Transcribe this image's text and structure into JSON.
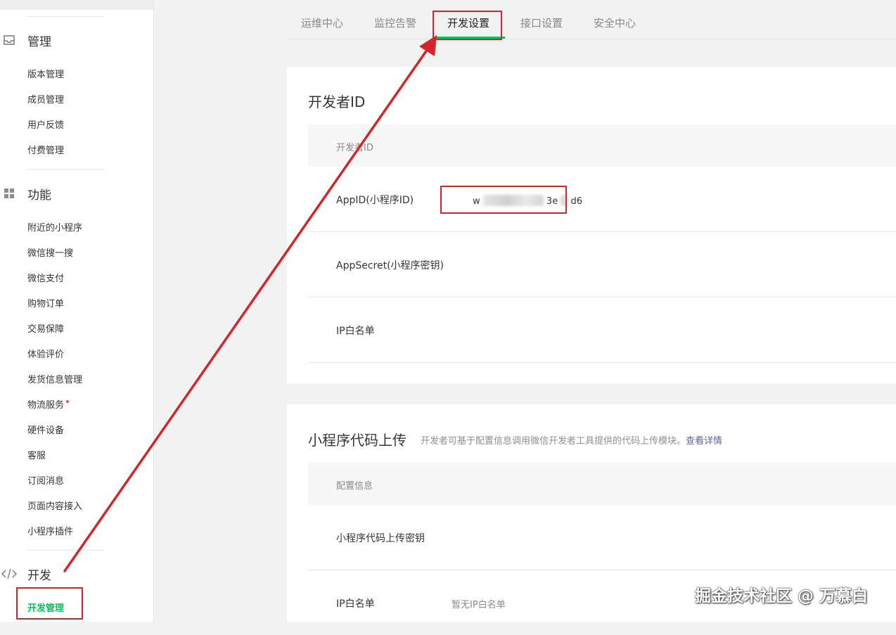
{
  "sidebar": {
    "sections": [
      {
        "title": "管理",
        "icon": "inbox-icon",
        "items": [
          "版本管理",
          "成员管理",
          "用户反馈",
          "付费管理"
        ]
      },
      {
        "title": "功能",
        "icon": "grid-icon",
        "items": [
          "附近的小程序",
          "微信搜一搜",
          "微信支付",
          "购物订单",
          "交易保障",
          "体验评价",
          "发货信息管理",
          "物流服务",
          "硬件设备",
          "客服",
          "订阅消息",
          "页面内容接入",
          "小程序插件"
        ]
      },
      {
        "title": "开发",
        "icon": "code-icon",
        "items": [
          "开发管理"
        ],
        "active_item": "开发管理"
      }
    ]
  },
  "tabs": [
    "运维中心",
    "监控告警",
    "开发设置",
    "接口设置",
    "安全中心"
  ],
  "active_tab": "开发设置",
  "developer_id": {
    "title": "开发者ID",
    "table_header": "开发者ID",
    "rows": [
      {
        "label": "AppID(小程序ID)",
        "value_prefix": "w",
        "value_suffix": "3e",
        "value_end": "d6"
      },
      {
        "label": "AppSecret(小程序密钥)",
        "value": ""
      },
      {
        "label": "IP白名单",
        "value": ""
      }
    ]
  },
  "code_upload": {
    "title": "小程序代码上传",
    "description": "开发者可基于配置信息调用微信开发者工具提供的代码上传模块。",
    "link": "查看详情",
    "table_header": "配置信息",
    "rows": [
      {
        "label": "小程序代码上传密钥",
        "value": ""
      },
      {
        "label": "IP白名单",
        "value": "暂无IP白名单"
      }
    ]
  },
  "watermark": "掘金技术社区 @ 万慕白",
  "colors": {
    "accent": "#07c160",
    "highlight": "#d3262a",
    "link": "#576b95"
  }
}
